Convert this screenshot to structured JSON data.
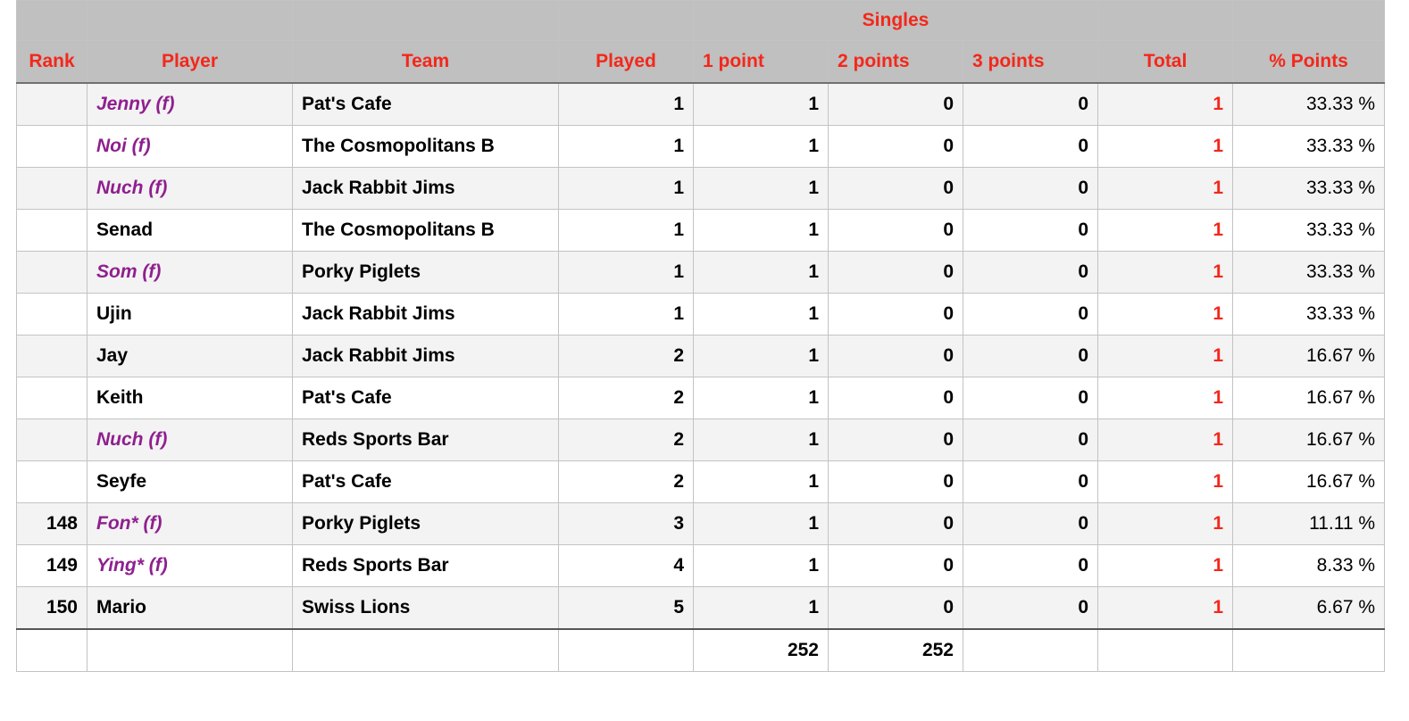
{
  "header": {
    "group_label": "Singles",
    "columns": {
      "rank": "Rank",
      "player": "Player",
      "team": "Team",
      "played": "Played",
      "one_point": "1 point",
      "two_points": "2 points",
      "three_points": "3 points",
      "total": "Total",
      "pct_points": "% Points"
    }
  },
  "colors": {
    "header_bg": "#bfc0bf",
    "header_text": "#f4271b",
    "female_name": "#8f1f8f",
    "total_text": "#f4271b"
  },
  "rows": [
    {
      "rank": "",
      "player": "Jenny (f)",
      "female": true,
      "team": "Pat's Cafe",
      "played": "1",
      "one_point": "1",
      "two_points": "0",
      "three_points": "0",
      "total": "1",
      "pct_points": "33.33 %"
    },
    {
      "rank": "",
      "player": "Noi (f)",
      "female": true,
      "team": "The Cosmopolitans B",
      "played": "1",
      "one_point": "1",
      "two_points": "0",
      "three_points": "0",
      "total": "1",
      "pct_points": "33.33 %"
    },
    {
      "rank": "",
      "player": "Nuch (f)",
      "female": true,
      "team": "Jack Rabbit Jims",
      "played": "1",
      "one_point": "1",
      "two_points": "0",
      "three_points": "0",
      "total": "1",
      "pct_points": "33.33 %"
    },
    {
      "rank": "",
      "player": "Senad",
      "female": false,
      "team": "The Cosmopolitans B",
      "played": "1",
      "one_point": "1",
      "two_points": "0",
      "three_points": "0",
      "total": "1",
      "pct_points": "33.33 %"
    },
    {
      "rank": "",
      "player": "Som (f)",
      "female": true,
      "team": "Porky Piglets",
      "played": "1",
      "one_point": "1",
      "two_points": "0",
      "three_points": "0",
      "total": "1",
      "pct_points": "33.33 %"
    },
    {
      "rank": "",
      "player": "Ujin",
      "female": false,
      "team": "Jack Rabbit Jims",
      "played": "1",
      "one_point": "1",
      "two_points": "0",
      "three_points": "0",
      "total": "1",
      "pct_points": "33.33 %"
    },
    {
      "rank": "",
      "player": "Jay",
      "female": false,
      "team": "Jack Rabbit Jims",
      "played": "2",
      "one_point": "1",
      "two_points": "0",
      "three_points": "0",
      "total": "1",
      "pct_points": "16.67 %"
    },
    {
      "rank": "",
      "player": "Keith",
      "female": false,
      "team": "Pat's Cafe",
      "played": "2",
      "one_point": "1",
      "two_points": "0",
      "three_points": "0",
      "total": "1",
      "pct_points": "16.67 %"
    },
    {
      "rank": "",
      "player": "Nuch (f)",
      "female": true,
      "team": "Reds Sports Bar",
      "played": "2",
      "one_point": "1",
      "two_points": "0",
      "three_points": "0",
      "total": "1",
      "pct_points": "16.67 %"
    },
    {
      "rank": "",
      "player": "Seyfe",
      "female": false,
      "team": "Pat's Cafe",
      "played": "2",
      "one_point": "1",
      "two_points": "0",
      "three_points": "0",
      "total": "1",
      "pct_points": "16.67 %"
    },
    {
      "rank": "148",
      "player": "Fon* (f)",
      "female": true,
      "team": "Porky Piglets",
      "played": "3",
      "one_point": "1",
      "two_points": "0",
      "three_points": "0",
      "total": "1",
      "pct_points": "11.11 %"
    },
    {
      "rank": "149",
      "player": "Ying* (f)",
      "female": true,
      "team": "Reds Sports Bar",
      "played": "4",
      "one_point": "1",
      "two_points": "0",
      "three_points": "0",
      "total": "1",
      "pct_points": "8.33 %"
    },
    {
      "rank": "150",
      "player": "Mario",
      "female": false,
      "team": "Swiss Lions",
      "played": "5",
      "one_point": "1",
      "two_points": "0",
      "three_points": "0",
      "total": "1",
      "pct_points": "6.67 %"
    }
  ],
  "footer": {
    "rank": "",
    "player": "",
    "team": "",
    "played": "",
    "one_point": "252",
    "two_points": "252",
    "three_points": "",
    "total": "",
    "pct_points": ""
  }
}
